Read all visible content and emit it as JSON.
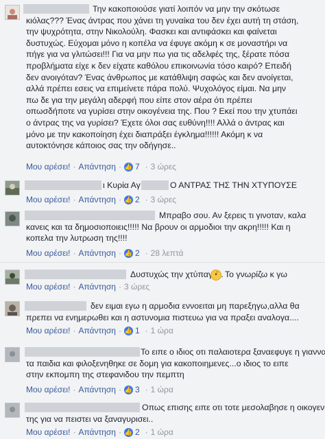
{
  "comments": [
    {
      "lines": [
        "Την κακοποιούσε γιατί λοιπόν να μην την σκότωσε",
        "κιόλας??? Ένας άντρας που χάνει τη γυναίκα του δεν έχει αυτή τη στάση,",
        "την ψυχρότητα, στην Νικολούλη. Φασκει και αντιφάσκει και φαίνεται",
        "δυστυχώς. Εύχομαι μόνο η κοπέλα να έφυγε ακόμη κ σε μοναστήρι να",
        "πήγε για να γλιτώσει!!! Για να μην πω για τις αδελφές της, ξέρατε πόσα",
        "προβλήματα είχε κ δεν είχατε καθόλου επικοινωνία τόσο καιρό? Επειδή",
        "δεν ανοιγόταν? Ένας άνθρωπος με κατάθλιψη σαφώς και δεν ανοίγεται,",
        "αλλά πρέπει εσεις να επιμείνετε πάρα πολύ. Ψυχολόγος είμαι. Να μην",
        "πω δε για την μεγάλη αδερφή που είπε στον αέρα ότι πρέπει",
        "οπωσδήποτε να γυρίσει στην οικογένεια της. Που ? Εκεί που την χτυπάει",
        "ο άντρας της να γυρίσει? Έχετε όλοι σας ευθύνη!!!! Αλλά ο άντρας και",
        "μόνο με την κακοποίηση έχει διαπράξει έγκλημα!!!!!! Ακόμη κ να",
        "αυτοκτόνησε κάποιος σας την οδήγησε.."
      ],
      "like": "Μου αρέσει!",
      "reply": "Απάντηση",
      "count": "7",
      "time": "3 ώρες"
    },
    {
      "lines": [
        "ι Κυρία Αγ",
        "Ο ΑΝΤΡΑΣ ΤΗΣ ΤΗΝ ΧΤΥΠΟΥΣΕ"
      ],
      "like": "Μου αρέσει!",
      "reply": "Απάντηση",
      "count": "2",
      "time": "3 ώρες"
    },
    {
      "lines": [
        "Μπραβο σου. Αν ξερεις τι γινοταν, καλα",
        "κανεις και τα δημοσιοποιεις!!!!! Να βρουν οι αρμοδιοι την ακρη!!!!! Και η",
        "κοπελα την λυτρωση της!!!!"
      ],
      "like": "Μου αρέσει!",
      "reply": "Απάντηση",
      "count": "2",
      "time": "28 λεπτά"
    },
    {
      "lines": [
        "Δυστυχώς την χτύπαγε...",
        "Το γνωρίζω κ γω"
      ],
      "like": "Μου αρέσει!",
      "reply": "Απάντηση",
      "time": "3 ώρες"
    },
    {
      "lines": [
        "δεν ειμαι εγω η αρμοδια εννοειται μη παρεξηγω,αλλα θα",
        "πρεπει να ενημερωθει και η αστυνομια πιστευω για να πραξει αναλογα...."
      ],
      "like": "Μου αρέσει!",
      "reply": "Απάντηση",
      "count": "1",
      "time": "1 ώρα"
    },
    {
      "lines": [
        "Το ειπε ο ιδιος οτι παλαιοτερα ξαναεφυγε η γιαννα με",
        "τα παιδια και φιλοξενηθηκε σε δομη για κακοποιημενες...ο ιδιος το ειπε",
        "στην εκπομπη της στεφανιδου την πεμπτη"
      ],
      "like": "Μου αρέσει!",
      "reply": "Απάντηση",
      "count": "3",
      "time": "1 ώρα"
    },
    {
      "lines": [
        "Οπως επισης ειπε οτι τοτε μεσολαβησε η οικογενεια",
        "της για να πειστει να ξαναγυρισει.."
      ],
      "like": "Μου αρέσει!",
      "reply": "Απάντηση",
      "count": "2",
      "time": "1 ώρα"
    }
  ],
  "icons": {
    "like_badge": "thumbs-up-icon",
    "emoji": "worried-face-icon"
  },
  "colors": {
    "link": "#365899",
    "like_badge": "#3b78e7",
    "muted": "#90949c"
  }
}
